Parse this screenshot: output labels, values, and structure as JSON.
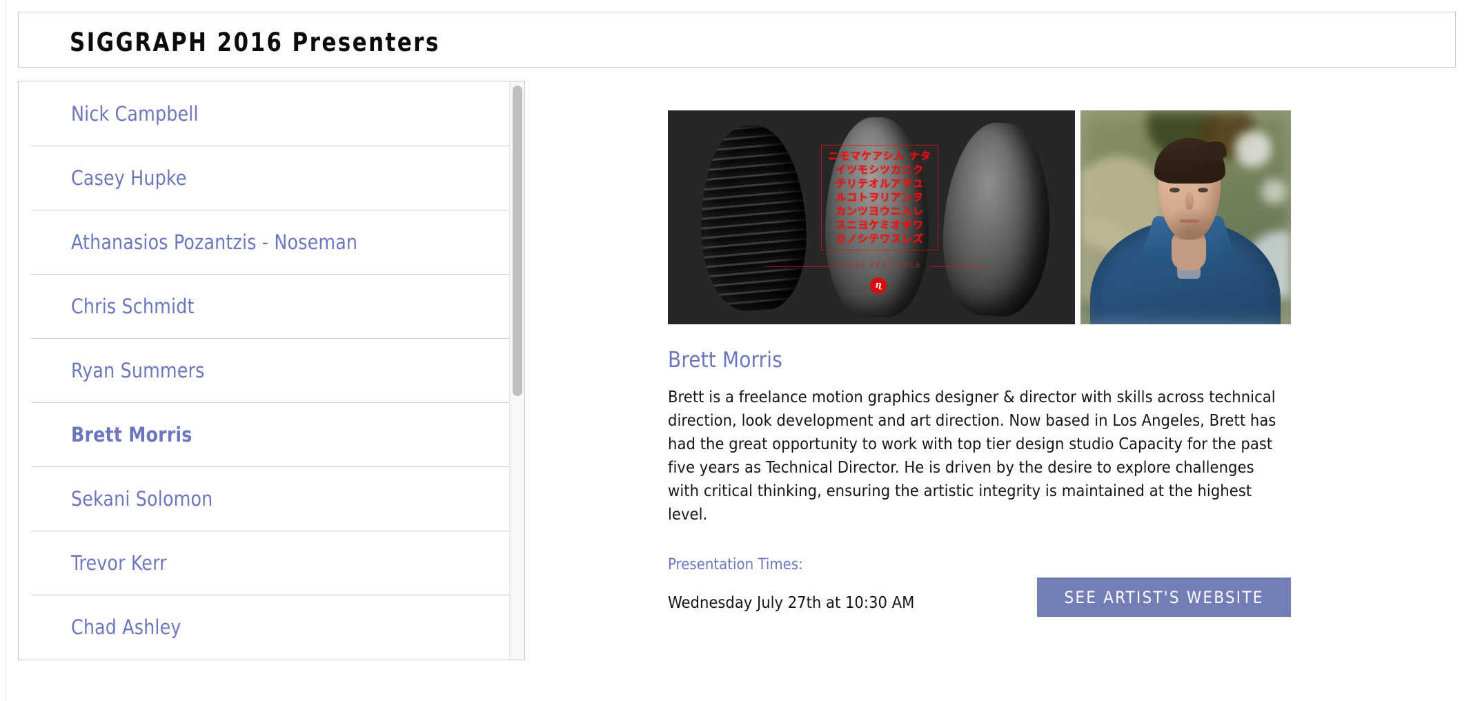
{
  "page": {
    "title": "SIGGRAPH 2016 Presenters"
  },
  "colors": {
    "link": "#6b76bd",
    "button_bg": "#737eb4",
    "button_text": "#ffffff",
    "body_text": "#151515",
    "border": "#c9c9c9",
    "row_divider": "#cfcfcf",
    "scrollbar_thumb": "#bfbfbf"
  },
  "presenter_list": {
    "selected": "Brett Morris",
    "items": [
      {
        "name": "Nick Campbell",
        "selected": false
      },
      {
        "name": "Casey Hupke",
        "selected": false
      },
      {
        "name": "Athanasios Pozantzis - Noseman",
        "selected": false
      },
      {
        "name": "Chris Schmidt",
        "selected": false
      },
      {
        "name": "Ryan Summers",
        "selected": false
      },
      {
        "name": "Brett Morris",
        "selected": true
      },
      {
        "name": "Sekani Solomon",
        "selected": false
      },
      {
        "name": "Trevor Kerr",
        "selected": false
      },
      {
        "name": "Chad Ashley",
        "selected": false
      }
    ]
  },
  "detail": {
    "artwork": {
      "alt": "Dark artwork with three sculpted busts and red katakana overlay",
      "overlay_text": "ニモマケアシ人 ナタ\nイツモシツカニク\nテリテオルアヲユ\nルコトヲリアンヲ\nカンツヨウニ入レ\nスニヨケミオギワ\nカノシテワスレズ",
      "footer_text": "PAUSE FEST 2016",
      "logo_glyph": "ɳ"
    },
    "portrait": {
      "alt": "Portrait photo of Brett Morris in a blue denim shirt"
    },
    "name": "Brett Morris",
    "bio": "Brett is a freelance motion graphics designer & director with skills across technical direction, look development and art direction. Now based in Los Angeles, Brett has had the great opportunity to work with top tier design studio Capacity for the past five years as Technical Director. He is driven by the desire to explore challenges with critical thinking, ensuring the artistic integrity is maintained at the highest level.",
    "presentation_times_label": "Presentation Times:",
    "presentation_time": "Wednesday July 27th at 10:30 AM",
    "website_button_label": "SEE ARTIST'S WEBSITE"
  }
}
